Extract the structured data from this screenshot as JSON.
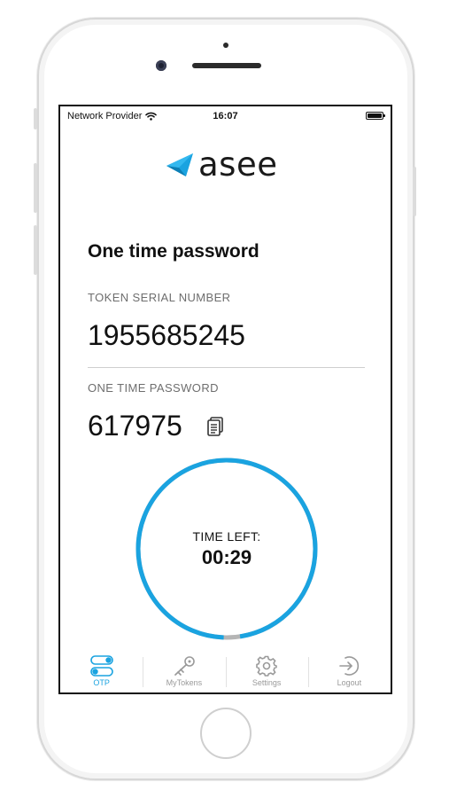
{
  "status_bar": {
    "carrier": "Network Provider",
    "time": "16:07"
  },
  "brand": {
    "name": "asee",
    "accent_color": "#1aa3e0"
  },
  "page": {
    "title": "One time password"
  },
  "token": {
    "serial_label": "TOKEN SERIAL NUMBER",
    "serial_value": "1955685245"
  },
  "otp": {
    "label": "ONE TIME PASSWORD",
    "value": "617975",
    "copy_icon": "copy-icon"
  },
  "timer": {
    "label": "TIME LEFT:",
    "value": "00:29",
    "remaining_fraction": 0.97,
    "ring_color": "#1aa3e0",
    "elapsed_color": "#b5b5b5"
  },
  "tab_bar": {
    "active": "otp",
    "tabs": [
      {
        "id": "otp",
        "label": "OTP",
        "icon": "toggle-icon"
      },
      {
        "id": "mytokens",
        "label": "MyTokens",
        "icon": "key-icon"
      },
      {
        "id": "settings",
        "label": "Settings",
        "icon": "gear-icon"
      },
      {
        "id": "logout",
        "label": "Logout",
        "icon": "logout-icon"
      }
    ]
  }
}
